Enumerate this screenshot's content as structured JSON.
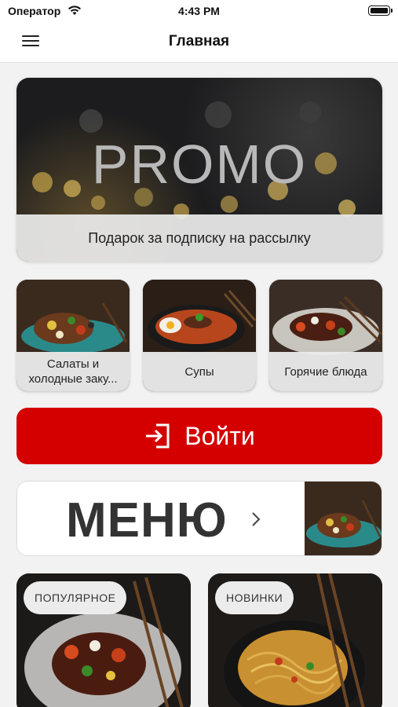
{
  "status_bar": {
    "carrier": "Оператор",
    "time": "4:43 PM"
  },
  "nav": {
    "title": "Главная",
    "menu_icon": "hamburger-menu-icon"
  },
  "promo": {
    "title": "PROMO",
    "caption": "Подарок за подписку на рассылку"
  },
  "categories": [
    {
      "label": "Салаты и холодные заку..."
    },
    {
      "label": "Супы"
    },
    {
      "label": "Горячие блюда"
    }
  ],
  "login": {
    "label": "Войти",
    "icon": "login-icon",
    "color": "#d40000"
  },
  "menu_card": {
    "title": "МЕНЮ",
    "icon": "chevron-right-icon"
  },
  "features": [
    {
      "badge": "ПОПУЛЯРНОЕ"
    },
    {
      "badge": "НОВИНКИ"
    }
  ]
}
